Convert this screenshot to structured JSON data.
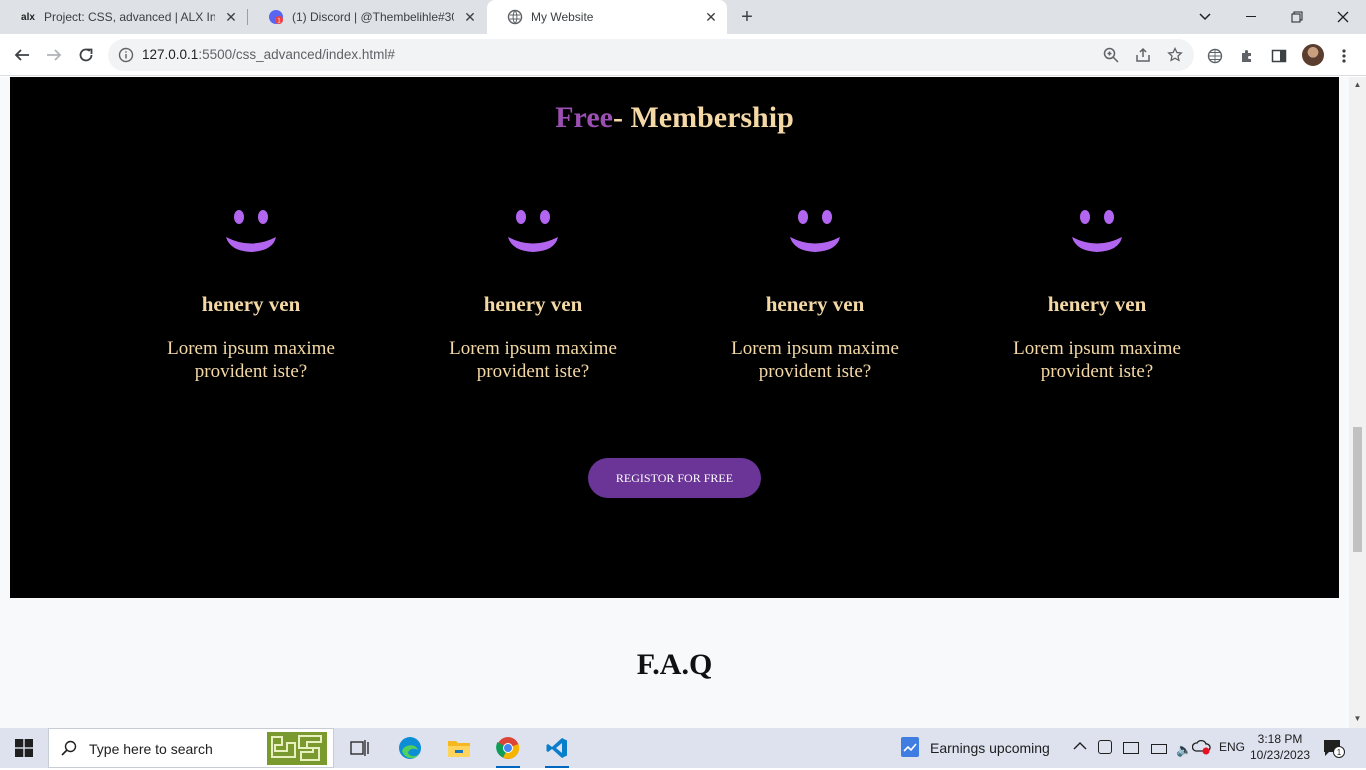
{
  "browser": {
    "tabs": [
      {
        "title": "Project: CSS, advanced | ALX Intr",
        "favicon": "alx-icon"
      },
      {
        "title": "(1) Discord | @Thembelihle#300",
        "favicon": "discord-icon",
        "badge": "1"
      },
      {
        "title": "My Website",
        "favicon": "globe-icon",
        "active": true
      }
    ],
    "new_tab": "+",
    "url_host": "127.0.0.1",
    "url_rest": ":5500/css_advanced/index.html#"
  },
  "page": {
    "membership": {
      "title_accent": "Free",
      "title_rest": "- Membership",
      "cards": [
        {
          "name": "henery ven",
          "text": "Lorem ipsum maxime provident iste?"
        },
        {
          "name": "henery ven",
          "text": "Lorem ipsum maxime provident iste?"
        },
        {
          "name": "henery ven",
          "text": "Lorem ipsum maxime provident iste?"
        },
        {
          "name": "henery ven",
          "text": "Lorem ipsum maxime provident iste?"
        }
      ],
      "button": "REGISTOR FOR FREE"
    },
    "faq_title": "F.A.Q"
  },
  "colors": {
    "accent_purple": "#6a3597",
    "title_gold": "#f4d9a6",
    "smiley": "#b266f0"
  },
  "taskbar": {
    "search_placeholder": "Type here to search",
    "weather": "Earnings upcoming",
    "language": "ENG",
    "time": "3:18 PM",
    "date": "10/23/2023",
    "notification_count": "1"
  }
}
